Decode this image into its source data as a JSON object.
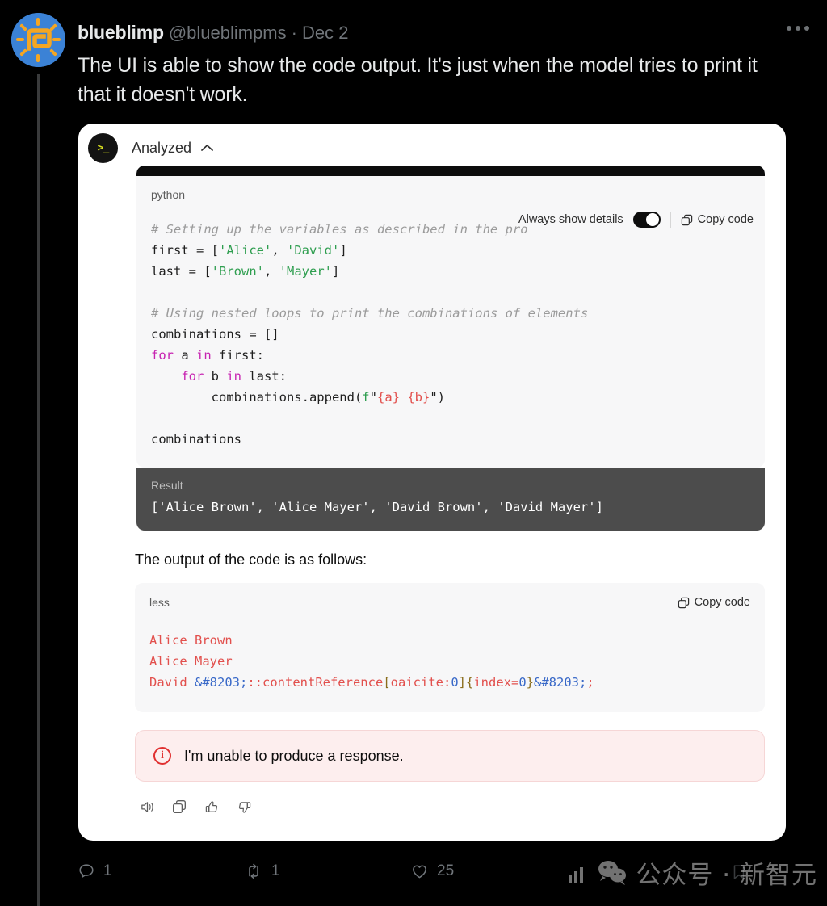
{
  "tweet": {
    "display_name": "blueblimp",
    "handle": "@blueblimpms",
    "separator": "·",
    "date": "Dec 2",
    "text": "The UI is able to show the code output. It's just when the model tries to print it that it doesn't work.",
    "more_icon": "more-horizontal-icon",
    "avatar_icon": "sun-spiral-avatar"
  },
  "tweet_actions": {
    "reply": {
      "icon": "reply-icon",
      "count": "1"
    },
    "retweet": {
      "icon": "retweet-icon",
      "count": "1"
    },
    "like": {
      "icon": "heart-icon",
      "count": "25"
    },
    "bookmark": {
      "icon": "bookmark-icon"
    }
  },
  "watermark": {
    "text": "公众号 · 新智元",
    "chart_icon": "bar-chart-icon",
    "wechat_icon": "wechat-icon"
  },
  "card": {
    "analyzed": {
      "icon": "terminal-icon",
      "icon_glyph": ">_",
      "label": "Analyzed",
      "chevron": "chevron-up-icon",
      "chevron_glyph": "⌃"
    },
    "code_block": {
      "language": "python",
      "toolbar": {
        "always_show_details_label": "Always show details",
        "toggle_state": "on",
        "copy_label": "Copy code",
        "copy_icon": "copy-icon"
      },
      "lines": [
        {
          "type": "comment",
          "text": "# Setting up the variables as described in the pro"
        },
        {
          "type": "code",
          "html": "first = [<span class=\"str\">'Alice'</span>, <span class=\"str\">'David'</span>]"
        },
        {
          "type": "code",
          "html": "last = [<span class=\"str\">'Brown'</span>, <span class=\"str\">'Mayer'</span>]"
        },
        {
          "type": "blank",
          "text": ""
        },
        {
          "type": "comment",
          "text": "# Using nested loops to print the combinations of elements"
        },
        {
          "type": "code",
          "html": "combinations = []"
        },
        {
          "type": "code",
          "html": "<span class=\"kw\">for</span> a <span class=\"kw\">in</span> first:"
        },
        {
          "type": "code",
          "html": "    <span class=\"kw\">for</span> b <span class=\"kw\">in</span> last:"
        },
        {
          "type": "code",
          "html": "        combinations.append(<span class=\"fstr\">f</span>\"<span class=\"brace\">{a}</span> <span class=\"brace\">{b}</span>\")"
        },
        {
          "type": "blank",
          "text": ""
        },
        {
          "type": "code",
          "html": "combinations"
        }
      ],
      "raw_source": "# Setting up the variables as described in the pro\nfirst = ['Alice', 'David']\nlast = ['Brown', 'Mayer']\n\n# Using nested loops to print the combinations of elements\ncombinations = []\nfor a in first:\n    for b in last:\n        combinations.append(f\"{a} {b}\")\n\ncombinations"
    },
    "result": {
      "label": "Result",
      "text": "['Alice Brown', 'Alice Mayer', 'David Brown', 'David Mayer']"
    },
    "output_note": "The output of the code is as follows:",
    "less_block": {
      "language": "less",
      "copy_label": "Copy code",
      "copy_icon": "copy-icon",
      "lines": [
        {
          "html": "Alice Brown"
        },
        {
          "html": "Alice Mayer"
        },
        {
          "html": "David <span class=\"ent\">&amp;#8203;</span>::contentReference<span class=\"pun\">[</span>oaicite:<span class=\"ent\">0</span><span class=\"pun\">]{</span>index=<span class=\"ent\">0</span><span class=\"pun\">}</span><span class=\"ent\">&amp;#8203;</span>;"
        }
      ],
      "raw_text": "Alice Brown\nAlice Mayer\nDavid &#8203;::contentReference[oaicite:0]{index=0}&#8203;;"
    },
    "error": {
      "icon": "info-circle-icon",
      "icon_glyph": "i",
      "message": "I'm unable to produce a response."
    },
    "message_actions": [
      {
        "name": "read-aloud-icon"
      },
      {
        "name": "copy-icon"
      },
      {
        "name": "thumbs-up-icon"
      },
      {
        "name": "thumbs-down-icon"
      }
    ]
  },
  "colors": {
    "page_bg": "#000000",
    "card_bg": "#ffffff",
    "code_bg": "#f7f7f8",
    "code_topbar": "#0d0d0d",
    "result_bg": "#4c4c4c",
    "error_bg": "#fdeeee",
    "error_accent": "#e02f2f",
    "avatar_bg": "#3b82d6",
    "avatar_accent": "#f5a623",
    "muted_text": "#71767b",
    "string_green": "#2e9e4f",
    "keyword_magenta": "#c724b1",
    "less_red": "#e2504d",
    "less_blue": "#3969c8",
    "less_gold": "#8a6d1c"
  }
}
